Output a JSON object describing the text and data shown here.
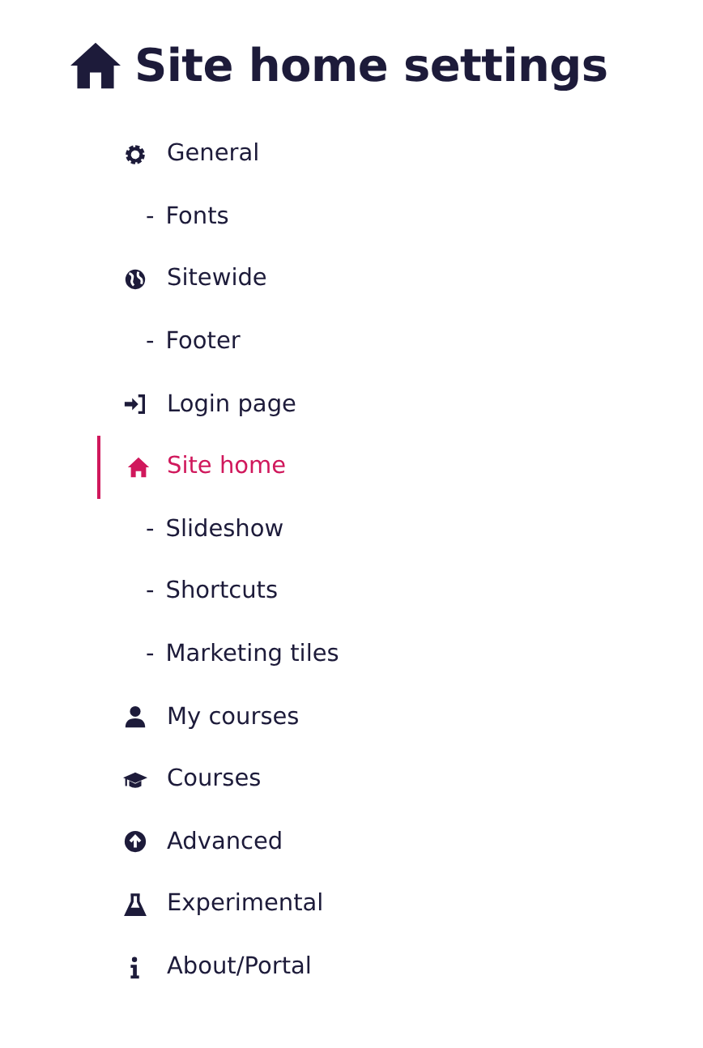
{
  "title": "Site home settings",
  "nav": [
    {
      "kind": "section",
      "label": "General",
      "selected": false
    },
    {
      "kind": "sub",
      "marker": "-",
      "label": "Fonts",
      "selected": false
    },
    {
      "kind": "section",
      "label": "Sitewide",
      "selected": false
    },
    {
      "kind": "sub",
      "marker": "-",
      "label": "Footer",
      "selected": false
    },
    {
      "kind": "section",
      "label": "Login page",
      "selected": false
    },
    {
      "kind": "section",
      "label": "Site home",
      "selected": true
    },
    {
      "kind": "sub",
      "marker": "-",
      "label": "Slideshow",
      "selected": false
    },
    {
      "kind": "sub",
      "marker": "-",
      "label": "Shortcuts",
      "selected": false
    },
    {
      "kind": "sub",
      "marker": "-",
      "label": "Marketing tiles",
      "selected": false
    },
    {
      "kind": "section",
      "label": "My courses",
      "selected": false
    },
    {
      "kind": "section",
      "label": "Courses",
      "selected": false
    },
    {
      "kind": "section",
      "label": "Advanced",
      "selected": false
    },
    {
      "kind": "section",
      "label": "Experimental",
      "selected": false
    },
    {
      "kind": "section",
      "label": "About/Portal",
      "selected": false
    }
  ]
}
